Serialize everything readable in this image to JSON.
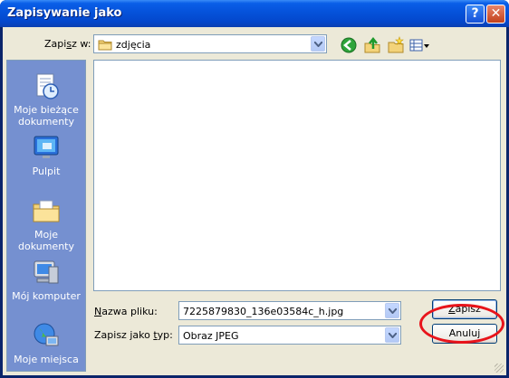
{
  "window": {
    "title": "Zapisywanie jako",
    "help_icon": "question-mark-icon",
    "close_icon": "close-x-icon"
  },
  "lookin": {
    "label_pre": "Zapi",
    "label_u": "s",
    "label_post": "z w:",
    "value": "zdjęcia",
    "folder_icon": "folder-icon"
  },
  "toolbar": {
    "back_icon": "back-arrow-icon",
    "up_icon": "up-folder-icon",
    "new_folder_icon": "new-folder-icon",
    "views_icon": "views-menu-icon"
  },
  "places": [
    {
      "label": "Moje bieżące dokumenty",
      "icon": "recent-documents-icon"
    },
    {
      "label": "Pulpit",
      "icon": "desktop-icon"
    },
    {
      "label": "Moje dokumenty",
      "icon": "my-documents-icon"
    },
    {
      "label": "Mój komputer",
      "icon": "my-computer-icon"
    },
    {
      "label": "Moje miejsca",
      "icon": "network-places-icon"
    }
  ],
  "filename": {
    "label_u": "N",
    "label_post": "azwa pliku:",
    "value": "7225879830_136e03584c_h.jpg"
  },
  "filetype": {
    "label_pre": "Zapisz jako ",
    "label_u": "t",
    "label_post": "yp:",
    "value": "Obraz JPEG"
  },
  "buttons": {
    "save_u": "Z",
    "save_post": "apisz",
    "cancel": "Anuluj"
  },
  "colors": {
    "title_bar": "#0552da",
    "dialog_bg": "#ece9d8",
    "places_bar": "#7590d0",
    "annotation_ring": "#e8141b"
  }
}
